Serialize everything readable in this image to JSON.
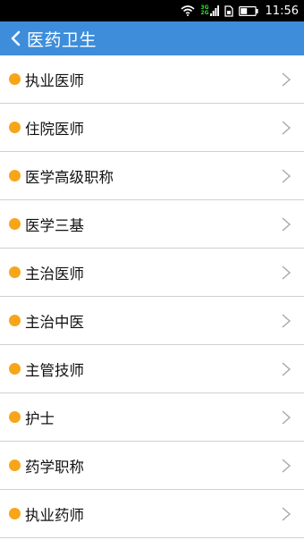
{
  "status_bar": {
    "network_top": "3G",
    "network_bottom": "2G",
    "time": "11:56",
    "icons": [
      "wifi-icon",
      "signal-icon",
      "sim-icon",
      "battery-icon"
    ]
  },
  "header": {
    "title": "医药卫生",
    "back_icon": "chevron-left-icon",
    "background_color": "#3d8ddb"
  },
  "list": {
    "bullet_color": "#f7a519",
    "chevron_icon": "chevron-right-icon",
    "items": [
      {
        "label": "执业医师"
      },
      {
        "label": "住院医师"
      },
      {
        "label": "医学高级职称"
      },
      {
        "label": "医学三基"
      },
      {
        "label": "主治医师"
      },
      {
        "label": "主治中医"
      },
      {
        "label": "主管技师"
      },
      {
        "label": "护士"
      },
      {
        "label": "药学职称"
      },
      {
        "label": "执业药师"
      }
    ]
  }
}
